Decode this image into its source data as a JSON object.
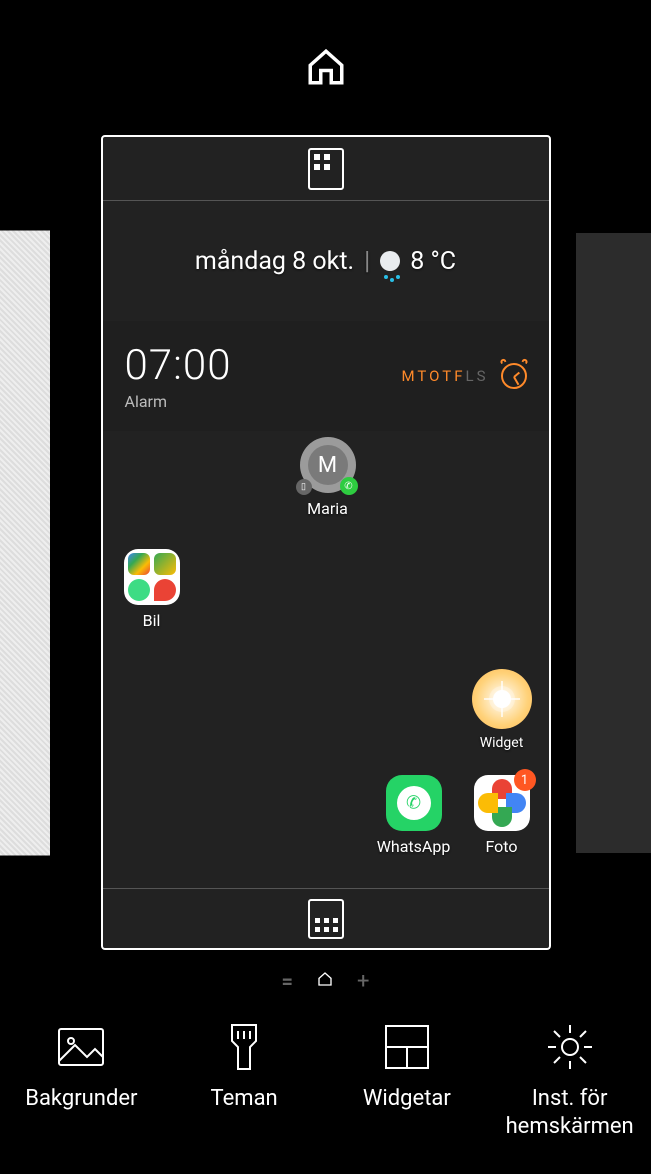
{
  "date_weather": {
    "date": "måndag 8 okt.",
    "temperature": "8 °C"
  },
  "alarm": {
    "time": "07:00",
    "label": "Alarm",
    "days": [
      {
        "letter": "M",
        "active": true
      },
      {
        "letter": "T",
        "active": true
      },
      {
        "letter": "O",
        "active": true
      },
      {
        "letter": "T",
        "active": true
      },
      {
        "letter": "F",
        "active": true
      },
      {
        "letter": "L",
        "active": false
      },
      {
        "letter": "S",
        "active": false
      }
    ]
  },
  "apps": {
    "maria": {
      "label": "Maria",
      "initial": "M"
    },
    "bil": {
      "label": "Bil"
    },
    "sun": {
      "label": "Widget"
    },
    "whatsapp": {
      "label": "WhatsApp"
    },
    "foto": {
      "label": "Foto",
      "badge": "1"
    }
  },
  "toolbar": {
    "wallpapers": "Bakgrunder",
    "themes": "Teman",
    "widgets": "Widgetar",
    "settings": "Inst. för hemskärmen"
  }
}
